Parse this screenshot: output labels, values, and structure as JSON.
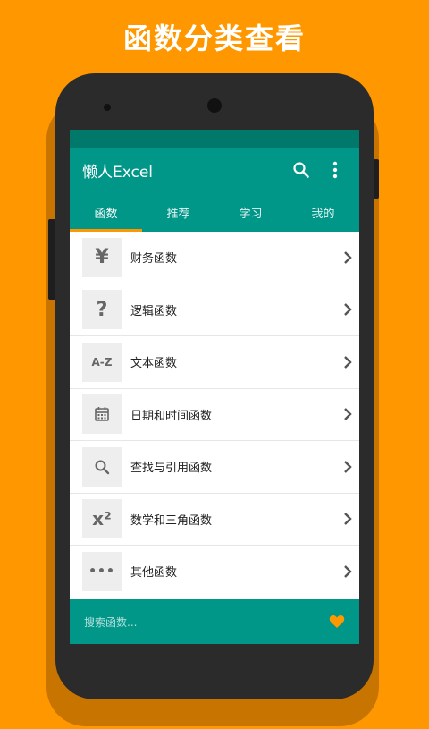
{
  "promo": {
    "title": "函数分类查看"
  },
  "app": {
    "title": "懒人Excel"
  },
  "tabs": [
    {
      "label": "函数"
    },
    {
      "label": "推荐"
    },
    {
      "label": "学习"
    },
    {
      "label": "我的"
    }
  ],
  "categories": [
    {
      "label": "财务函数",
      "icon": "yen-icon",
      "glyph": "¥"
    },
    {
      "label": "逻辑函数",
      "icon": "question-icon",
      "glyph": "?"
    },
    {
      "label": "文本函数",
      "icon": "az-icon",
      "glyph": "A-Z"
    },
    {
      "label": "日期和时间函数",
      "icon": "calendar-icon",
      "glyph": ""
    },
    {
      "label": "查找与引用函数",
      "icon": "search-icon",
      "glyph": ""
    },
    {
      "label": "数学和三角函数",
      "icon": "x-squared-icon",
      "glyph": "x²"
    },
    {
      "label": "其他函数",
      "icon": "more-icon",
      "glyph": "•••"
    }
  ],
  "bottom": {
    "search_placeholder": "搜索函数..."
  },
  "colors": {
    "accent": "#FF9800",
    "primary": "#009688",
    "status": "#00796B"
  }
}
